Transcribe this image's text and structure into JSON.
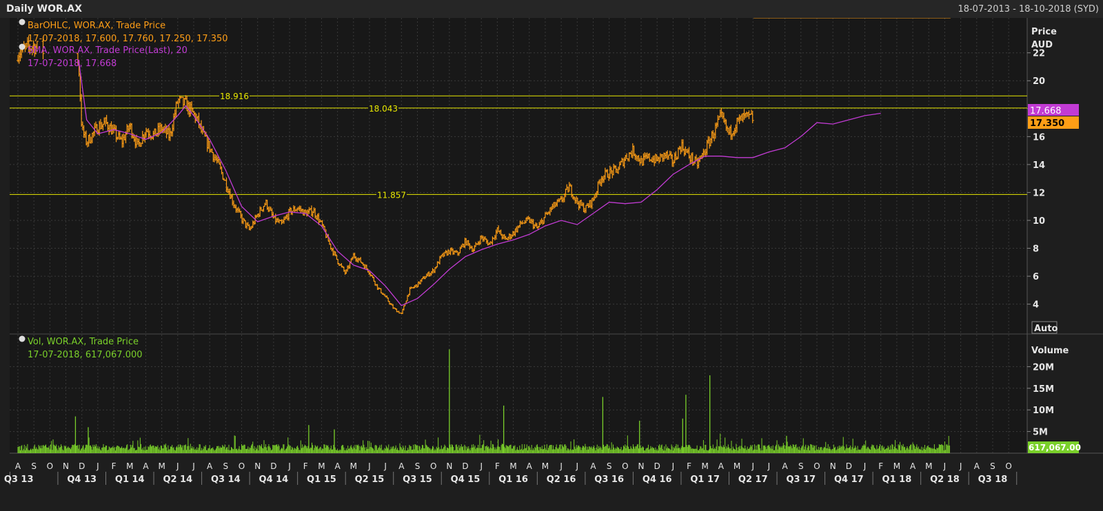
{
  "header": {
    "title": "Daily WOR.AX",
    "date_range": "18-07-2013 - 18-10-2018 (SYD)"
  },
  "colors": {
    "price": "#ff9e16",
    "sma": "#c23bd4",
    "volume": "#7ad02a",
    "hline": "#e8e800",
    "grid": "#3a3a3a"
  },
  "legend": {
    "bar_title": "BarOHLC, WOR.AX, Trade Price",
    "bar_values": "17-07-2018, 17.600, 17.760, 17.250, 17.350",
    "sma_title": "SMA, WOR.AX, Trade Price(Last),  20",
    "sma_values": "17-07-2018, 17.668",
    "vol_title": "Vol, WOR.AX, Trade Price",
    "vol_values": "17-07-2018, 617,067.000"
  },
  "axes": {
    "price_label_1": "Price",
    "price_label_2": "AUD",
    "auto_button": "Auto",
    "volume_label": "Volume",
    "volume_ticks": [
      "20M",
      "15M",
      "10M",
      "5M"
    ],
    "price_ticks": [
      "22",
      "20",
      "18",
      "16",
      "14",
      "12",
      "10",
      "8",
      "6",
      "4"
    ],
    "months": [
      "A",
      "S",
      "O",
      "N",
      "D",
      "J",
      "F",
      "M",
      "A",
      "M",
      "J",
      "J",
      "A",
      "S",
      "O",
      "N",
      "D",
      "J",
      "F",
      "M",
      "A",
      "M",
      "J",
      "J",
      "A",
      "S",
      "O",
      "N",
      "D",
      "J",
      "F",
      "M",
      "A",
      "M",
      "J",
      "J",
      "A",
      "S",
      "O",
      "N",
      "D",
      "J",
      "F",
      "M",
      "A",
      "M",
      "J",
      "J",
      "A",
      "S",
      "O",
      "N",
      "D",
      "J",
      "F",
      "M",
      "A",
      "M",
      "J",
      "J",
      "A",
      "S",
      "O"
    ],
    "quarters": [
      "Q3 13",
      "Q4 13",
      "Q1 14",
      "Q2 14",
      "Q3 14",
      "Q4 14",
      "Q1 15",
      "Q2 15",
      "Q3 15",
      "Q4 15",
      "Q1 16",
      "Q2 16",
      "Q3 16",
      "Q4 16",
      "Q1 17",
      "Q2 17",
      "Q3 17",
      "Q4 17",
      "Q1 18",
      "Q2 18",
      "Q3 18"
    ]
  },
  "badges": {
    "sma_last": "17.668",
    "price_last": "17.350",
    "volume_last": "617,067.00"
  },
  "chart_data": {
    "type": "line",
    "title": "Daily WOR.AX",
    "x_unit": "months since Aug 2013",
    "price_series": [
      {
        "name": "BarOHLC, WOR.AX, Trade Price",
        "x": [
          0,
          0.5,
          1.0,
          2.5,
          3.8,
          4.0,
          4.3,
          4.7,
          5.0,
          5.5,
          6.0,
          6.5,
          7.0,
          7.5,
          8.0,
          8.5,
          9.0,
          9.5,
          10.0,
          10.5,
          11.0,
          11.3,
          11.5,
          12.0,
          12.5,
          13.0,
          13.5,
          14.0,
          14.5,
          15.0,
          15.5,
          16.0,
          16.5,
          17.0,
          17.5,
          18.0,
          18.5,
          19.0,
          19.5,
          20.0,
          20.5,
          21.0,
          21.5,
          22.0,
          22.5,
          23.0,
          23.5,
          24.0,
          24.5,
          25.0,
          25.5,
          26.0,
          26.5,
          27.0,
          27.5,
          28.0,
          28.5,
          29.0,
          29.5,
          30.0,
          30.5,
          31.0,
          31.5,
          32.0,
          32.5,
          33.0,
          33.5,
          34.0,
          34.5,
          35.0,
          35.5,
          36.0,
          36.5,
          37.0,
          37.5,
          38.0,
          38.5,
          39.0,
          39.5,
          40.0,
          40.5,
          41.0,
          41.5,
          42.0,
          42.5,
          43.0,
          43.5,
          44.0,
          44.5,
          45.0,
          45.5,
          46.0,
          46.5,
          47.0,
          47.5,
          48.0,
          48.5,
          49.0,
          49.5,
          50.0,
          50.5,
          51.0,
          51.5,
          52.0,
          52.5,
          53.0,
          53.5,
          54.0,
          54.5,
          55.0,
          55.5,
          56.0,
          56.5,
          57.0,
          57.5,
          58.0,
          58.3
        ],
        "y": [
          22.0,
          22.3,
          22.5,
          21.5,
          21.3,
          16.5,
          15.6,
          16.2,
          16.7,
          17.0,
          16.3,
          15.6,
          16.8,
          15.3,
          16.5,
          16.1,
          16.6,
          16.0,
          18.6,
          18.3,
          17.6,
          17.0,
          16.3,
          15.2,
          14.1,
          12.7,
          11.2,
          10.1,
          9.3,
          10.4,
          11.3,
          10.1,
          9.7,
          10.6,
          10.9,
          10.5,
          10.7,
          9.7,
          8.3,
          7.1,
          6.2,
          7.5,
          7.0,
          6.3,
          5.2,
          4.5,
          3.7,
          3.3,
          5.0,
          5.4,
          6.0,
          6.4,
          7.4,
          7.8,
          7.6,
          8.5,
          7.9,
          8.8,
          8.3,
          9.3,
          8.6,
          9.1,
          9.8,
          10.0,
          9.4,
          10.3,
          11.0,
          11.4,
          12.4,
          11.3,
          10.8,
          11.5,
          13.1,
          13.4,
          13.6,
          14.5,
          15.0,
          14.2,
          14.5,
          14.3,
          14.7,
          14.2,
          15.4,
          14.6,
          14.0,
          15.0,
          16.2,
          17.4,
          16.2,
          17.0,
          17.4,
          17.3
        ]
      },
      {
        "name": "SMA, WOR.AX, Trade Price(Last),  20",
        "x": [
          3.8,
          4.3,
          5.0,
          6.0,
          7.0,
          8.0,
          9.0,
          10.0,
          10.5,
          11.0,
          12.0,
          13.0,
          14.0,
          15.0,
          16.0,
          17.0,
          18.0,
          19.0,
          20.0,
          21.0,
          22.0,
          23.0,
          24.0,
          25.0,
          26.0,
          27.0,
          28.0,
          29.0,
          30.0,
          31.0,
          32.0,
          33.0,
          34.0,
          35.0,
          36.0,
          37.0,
          38.0,
          39.0,
          40.0,
          41.0,
          42.0,
          43.0,
          44.0,
          45.0,
          46.0,
          47.0,
          48.0,
          49.0,
          50.0,
          51.0,
          52.0,
          53.0,
          54.0,
          55.0,
          56.0,
          57.0,
          58.0
        ],
        "y": [
          21.5,
          17.2,
          16.2,
          16.5,
          16.2,
          15.8,
          16.3,
          17.5,
          18.2,
          17.5,
          15.8,
          13.6,
          11.0,
          9.9,
          10.3,
          10.6,
          10.5,
          9.6,
          7.8,
          6.8,
          6.4,
          5.3,
          3.9,
          4.4,
          5.4,
          6.5,
          7.4,
          7.9,
          8.3,
          8.6,
          9.0,
          9.6,
          10.0,
          9.7,
          10.5,
          11.3,
          11.2,
          11.3,
          12.2,
          13.3,
          14.0,
          14.6,
          14.6,
          14.5,
          14.5,
          14.9,
          15.2,
          16.0,
          17.0,
          16.9,
          17.2,
          17.5,
          17.668
        ]
      }
    ],
    "volume_series": {
      "name": "Vol, WOR.AX, Trade Price",
      "unit": "shares",
      "spikes": [
        {
          "x": 3.6,
          "value": 8500000
        },
        {
          "x": 4.4,
          "value": 6000000
        },
        {
          "x": 18.2,
          "value": 6500000
        },
        {
          "x": 19.8,
          "value": 5500000
        },
        {
          "x": 27.0,
          "value": 24000000
        },
        {
          "x": 30.4,
          "value": 11000000
        },
        {
          "x": 36.6,
          "value": 13000000
        },
        {
          "x": 38.9,
          "value": 7500000
        },
        {
          "x": 41.6,
          "value": 8000000
        },
        {
          "x": 41.8,
          "value": 13500000
        },
        {
          "x": 43.3,
          "value": 18000000
        },
        {
          "x": 48.1,
          "value": 4000000
        }
      ]
    },
    "reference_lines": [
      18.916,
      18.043,
      11.857
    ],
    "ylim_price": [
      2.7,
      24.5
    ],
    "ylim_volume": [
      0,
      25000000
    ],
    "grid": true,
    "legend": "top-left"
  }
}
